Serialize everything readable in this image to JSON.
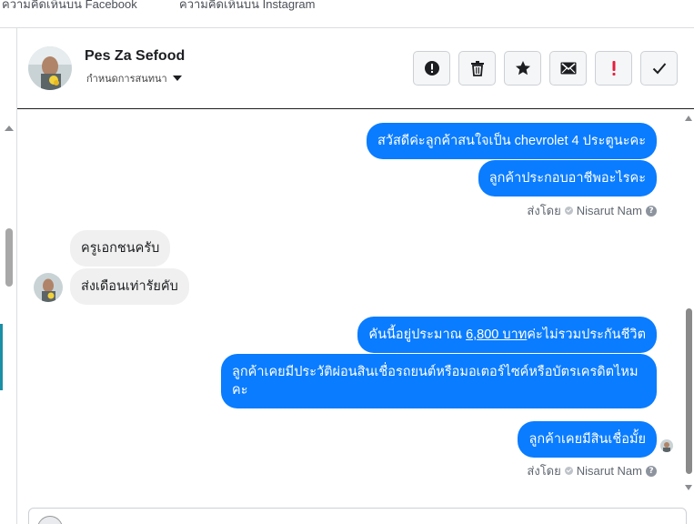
{
  "top_tabs": [
    "ความคิดเห็นบน Facebook",
    "ความคิดเห็นบน Instagram"
  ],
  "header": {
    "name": "Pes Za Sefood",
    "subtitle": "กำหนดการสนทนา",
    "actions": [
      {
        "icon": "alert-circle-icon",
        "label": "spam"
      },
      {
        "icon": "trash-icon",
        "label": "delete"
      },
      {
        "icon": "star-icon",
        "label": "star"
      },
      {
        "icon": "envelope-icon",
        "label": "mark unread"
      },
      {
        "icon": "exclamation-icon",
        "label": "follow up"
      },
      {
        "icon": "checkmark-icon",
        "label": "done"
      }
    ]
  },
  "messages": {
    "out1": "สวัสดีค่ะลูกค้าสนใจเป็น chevrolet 4 ประตูนะคะ",
    "out2": "ลูกค้าประกอบอาชีพอะไรคะ",
    "sent_by_1": {
      "prefix": "ส่งโดย",
      "name": "Nisarut Nam"
    },
    "in1": "ครูเอกชนครับ",
    "in2": "ส่งเดือนเท่ารัยคับ",
    "out3_before": "คันนี้อยู่ประมาณ ",
    "out3_amount": "6,800 บาท",
    "out3_after": "ค่ะไม่รวมประกันชีวิต",
    "out4": "ลูกค้าเคยมีประวัติผ่อนสินเชื่อรถยนต์หรือมอเตอร์ไซค์หรือบัตรเครดิตไหมคะ",
    "out5": "ลูกค้าเคยมีสินเชื่อมั้ย",
    "sent_by_2": {
      "prefix": "ส่งโดย",
      "name": "Nisarut Nam"
    }
  },
  "colors": {
    "outgoing_bubble": "#0a7cff",
    "incoming_bubble": "#f0f0f0",
    "accent_left": "#1a8fa6",
    "flag_red": "#e41e3f"
  }
}
